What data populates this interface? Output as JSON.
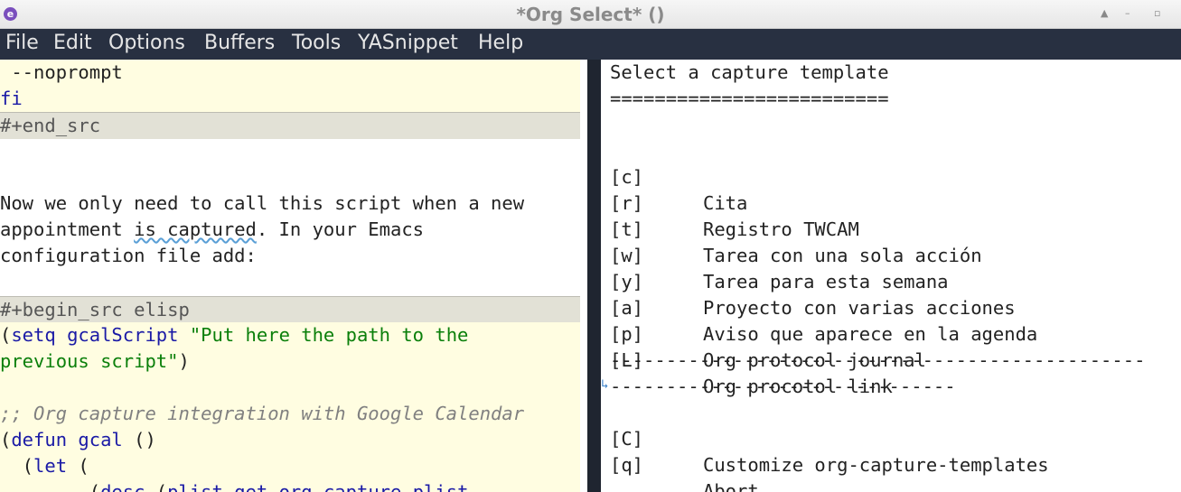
{
  "window": {
    "title": "*Org Select* ()"
  },
  "menu": [
    "File",
    "Edit",
    "Options",
    "Buffers",
    "Tools",
    "YASnippet",
    "Help"
  ],
  "left_pane": {
    "lines": [
      {
        "type": "src",
        "text": " --noprompt"
      },
      {
        "type": "src",
        "text": "fi",
        "class": "kw"
      },
      {
        "type": "hdr",
        "text": "#+end_src"
      },
      {
        "type": "blank",
        "text": ""
      },
      {
        "type": "blank",
        "text": ""
      },
      {
        "type": "text",
        "text": "Now we only need to call this script when a new"
      },
      {
        "type": "text",
        "text": "appointment is captured. In your Emacs"
      },
      {
        "type": "text",
        "text": "configuration file add:"
      },
      {
        "type": "blank",
        "text": ""
      },
      {
        "type": "hdr",
        "text": "#+begin_src elisp"
      },
      {
        "type": "src",
        "text": "(setq gcalScript \"Put here the path to the"
      },
      {
        "type": "src",
        "text": "previous script\")"
      },
      {
        "type": "src",
        "text": ""
      },
      {
        "type": "src",
        "text": ";; Org capture integration with Google Calendar"
      },
      {
        "type": "src",
        "text": "(defun gcal ()"
      },
      {
        "type": "src",
        "text": "  (let ("
      },
      {
        "type": "src",
        "text": "        (desc (plist-get org-capture-plist"
      }
    ]
  },
  "right_pane": {
    "heading": "Select a capture template",
    "underline": "=========================",
    "templates": [
      {
        "key": "[c]",
        "label": "Cita"
      },
      {
        "key": "[r]",
        "label": "Registro TWCAM"
      },
      {
        "key": "[t]",
        "label": "Tarea con una sola acción"
      },
      {
        "key": "[w]",
        "label": "Tarea para esta semana"
      },
      {
        "key": "[y]",
        "label": "Proyecto con varias acciones"
      },
      {
        "key": "[a]",
        "label": "Aviso que aparece en la agenda"
      },
      {
        "key": "[p]",
        "label": "Org protocol journal"
      },
      {
        "key": "[L]",
        "label": "Org procotol link"
      }
    ],
    "separator1": "------------------------------------------------",
    "separator2": "-------------------------------",
    "actions": [
      {
        "key": "[C]",
        "label": "Customize org-capture-templates"
      },
      {
        "key": "[q]",
        "label": "Abort"
      }
    ]
  },
  "colors": {
    "menubar_bg": "#283041",
    "src_bg": "#fffde1",
    "header_bg": "#e2e1d6",
    "keyword": "#1a1aa6",
    "string": "#0a7f0a"
  }
}
